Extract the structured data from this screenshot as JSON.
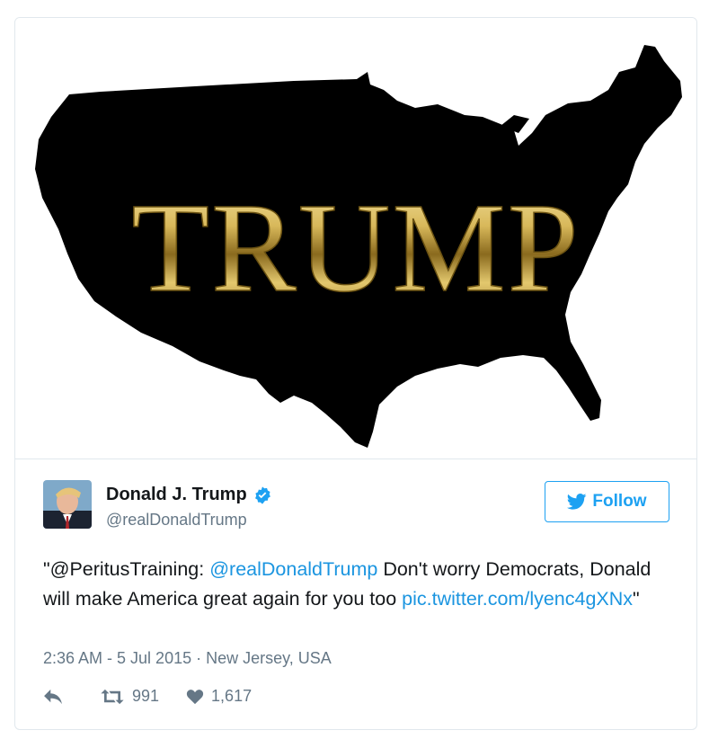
{
  "media": {
    "overlay_text": "TRUMP",
    "map_color": "#000000",
    "text_color": "#c9a94b"
  },
  "author": {
    "name": "Donald J. Trump",
    "handle": "@realDonaldTrump",
    "verified": true
  },
  "follow_button": {
    "label": "Follow",
    "color": "#1da1f2"
  },
  "tweet": {
    "text_prefix": "\"@PeritusTraining: ",
    "mention": "@realDonaldTrump",
    "text_body": " Don't worry Democrats, Donald will make America great again for you too ",
    "link": "pic.twitter.com/lyenc4gXNx",
    "text_suffix": "\""
  },
  "meta": {
    "time": "2:36 AM - 5 Jul 2015",
    "separator": " · ",
    "location": "New Jersey, USA"
  },
  "actions": {
    "reply_icon": "reply-icon",
    "retweet_icon": "retweet-icon",
    "retweet_count": "991",
    "like_icon": "heart-icon",
    "like_count": "1,617"
  }
}
